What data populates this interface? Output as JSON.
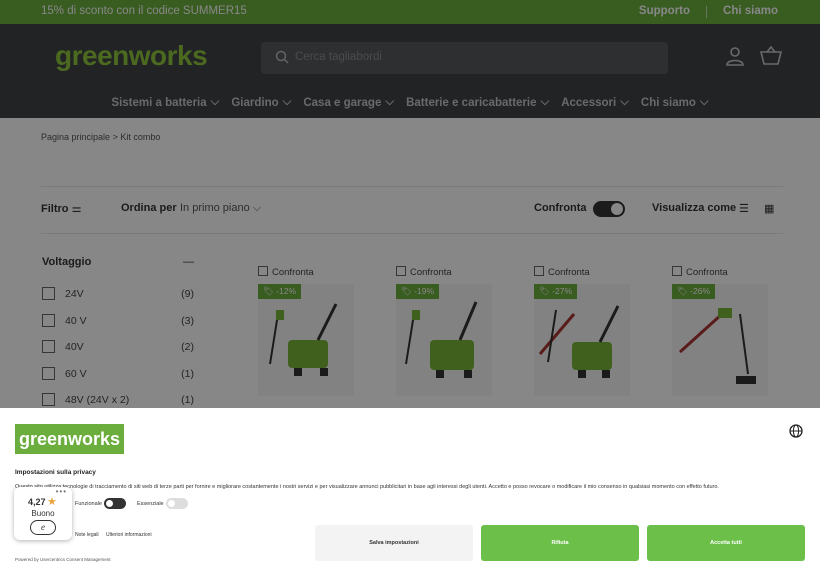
{
  "promo": {
    "text": "15% di sconto con il codice SUMMER15",
    "links": [
      "Supporto",
      "Chi siamo"
    ]
  },
  "header": {
    "logo": "greenworks",
    "search_placeholder": "Cerca tagliabordi",
    "nav": [
      "Sistemi a batteria",
      "Giardino",
      "Casa e garage",
      "Batterie e caricabatterie",
      "Accessori",
      "Chi siamo"
    ]
  },
  "breadcrumb": [
    "Pagina principale",
    "Kit combo"
  ],
  "toolbar": {
    "filter_label": "Filtro",
    "sort_label": "Ordina per",
    "sort_value": "In primo piano",
    "compare_label": "Confronta",
    "view_label": "Visualizza come"
  },
  "filters": {
    "title": "Voltaggio",
    "collapse_symbol": "—",
    "items": [
      {
        "label": "24V",
        "count": "(9)"
      },
      {
        "label": "40 V",
        "count": "(3)"
      },
      {
        "label": "40V",
        "count": "(2)"
      },
      {
        "label": "60 V",
        "count": "(1)"
      },
      {
        "label": "48V (24V x 2)",
        "count": "(1)"
      }
    ]
  },
  "products": [
    {
      "compare": "Confronta",
      "badge": "-12%"
    },
    {
      "compare": "Confronta",
      "badge": "-19%"
    },
    {
      "compare": "Confronta",
      "badge": "-27%"
    },
    {
      "compare": "Confronta",
      "badge": "-26%"
    }
  ],
  "consent": {
    "logo": "greenworks",
    "title": "Impostazioni sulla privacy",
    "text": "Questo sito utilizza tecnologie di tracciamento di siti web di terze parti per fornire e migliorare costantemente i nostri servizi e per visualizzare annunci pubblicitari in base agli interessi degli utenti. Accetto e posso revocare o modificare il mio consenso in qualsiasi momento con effetto futuro.",
    "switch_functional": "Funzionale",
    "switch_essential": "Essenziale",
    "link_legal": "Note legali",
    "link_more": "Ulteriori informazioni",
    "powered": "Powered by Usercentrics Consent Management",
    "btn_settings": "Salva impostazioni",
    "btn_reject": "Rifiuta",
    "btn_accept": "Accetta tutti"
  },
  "rating": {
    "score": "4,27",
    "label": "Buono",
    "badge": "e",
    "dots": "•••"
  },
  "colors": {
    "brand_green": "#6cae3e",
    "header_dark": "#3f4347",
    "button_green": "#6cc04a"
  }
}
